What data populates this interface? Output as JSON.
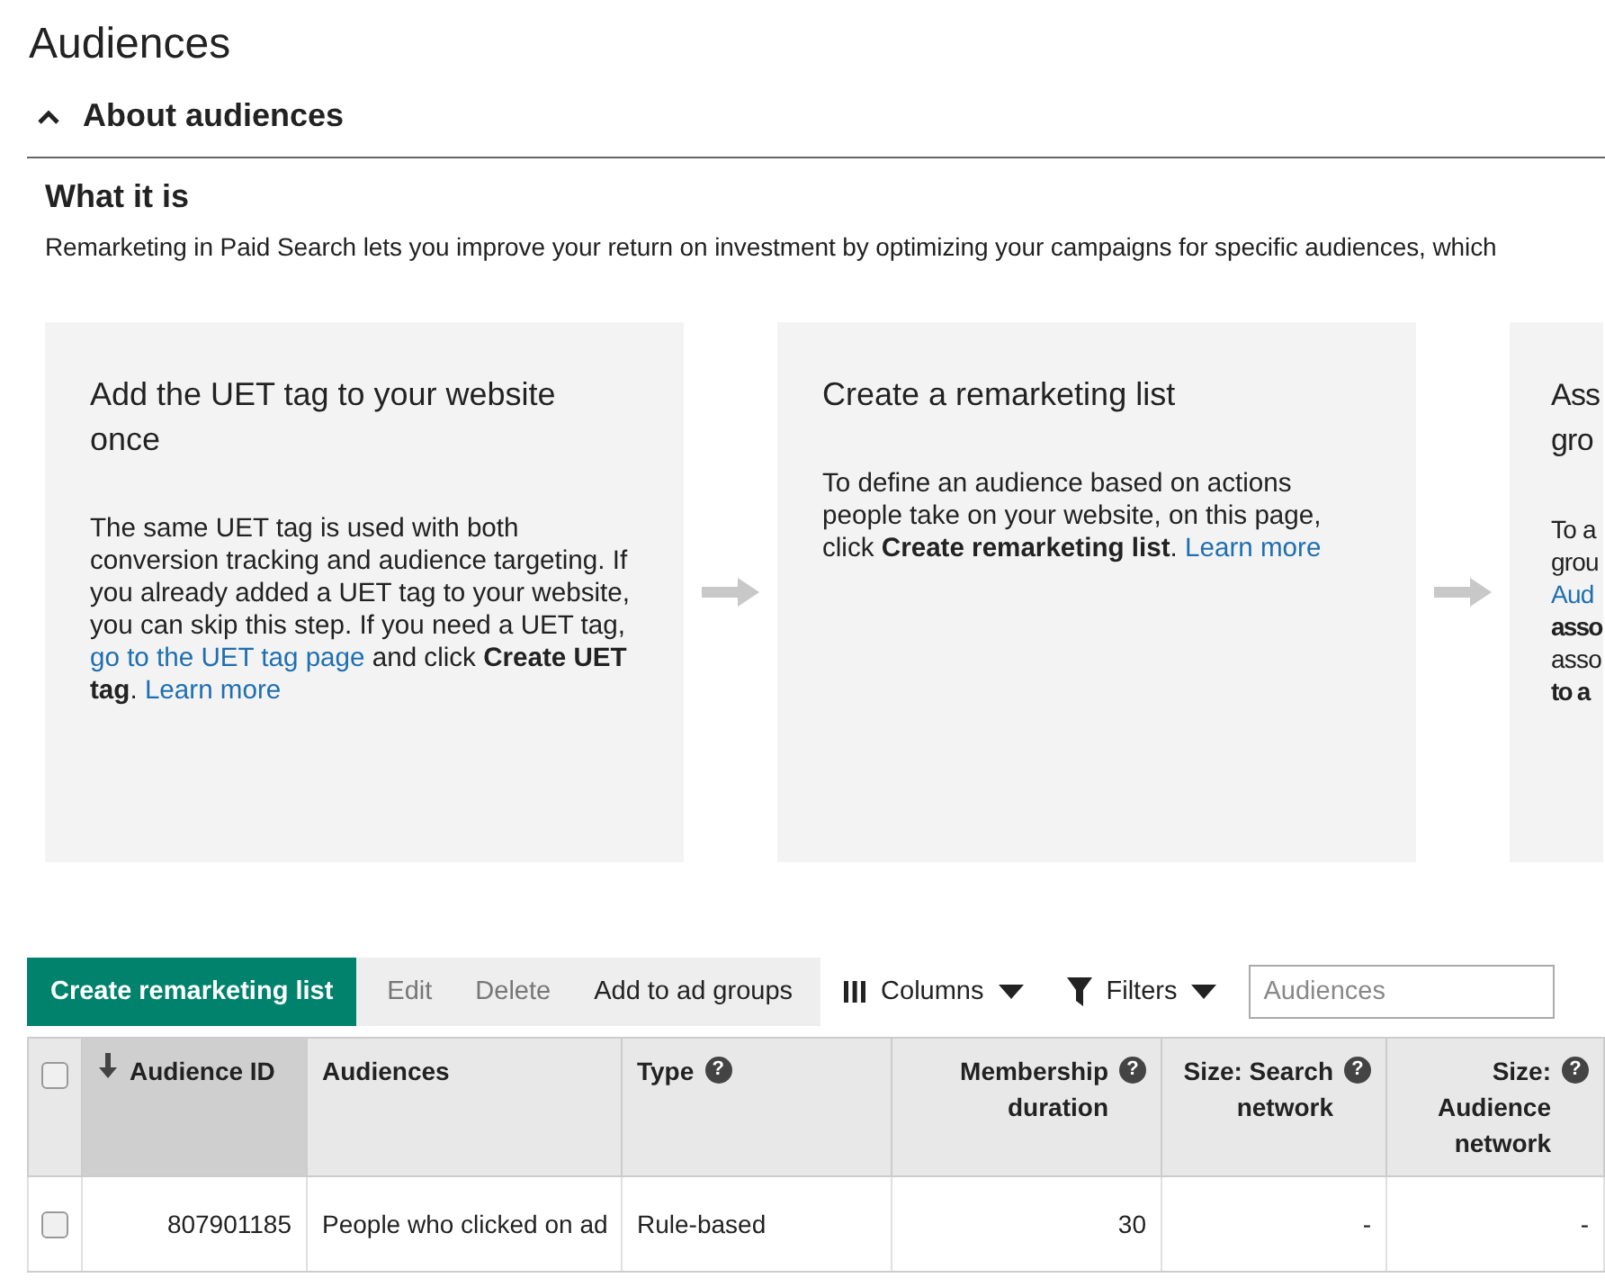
{
  "page_title": "Audiences",
  "section": {
    "title": "About audiences",
    "expanded": true
  },
  "what_it_is": {
    "heading": "What it is",
    "text": "Remarketing in Paid Search lets you improve your return on investment by optimizing your campaigns for specific audiences, which"
  },
  "steps": [
    {
      "title": "Add the UET tag to your website once",
      "body": [
        {
          "text": "The same UET tag is used with both conversion tracking and audience targeting. If you already added a UET tag to your website, you can skip this step. If you need a UET tag,",
          "kind": "text"
        },
        {
          "text": "go to the UET tag page",
          "kind": "link"
        },
        {
          "text": "and click **Create UET tag**.",
          "kind": "text"
        },
        {
          "text": "Learn more",
          "kind": "link"
        }
      ]
    },
    {
      "title": "Create a remarketing list",
      "body": [
        {
          "text": "To define an audience based on actions people take on your website, on this page, click **Create remarketing list**.",
          "kind": "text"
        },
        {
          "text": "Learn more",
          "kind": "link"
        }
      ]
    },
    {
      "title_lines": [
        "Ass",
        "gro"
      ],
      "body_lines": [
        {
          "text": "To a",
          "kind": "plain"
        },
        {
          "text": "grou",
          "kind": "plain"
        },
        {
          "text": "Aud",
          "kind": "link"
        },
        {
          "text": "asso",
          "kind": "bold"
        },
        {
          "text": "asso",
          "kind": "plain"
        },
        {
          "text": "to a",
          "kind": "bold"
        }
      ]
    }
  ],
  "toolbar": {
    "primary": "Create remarketing list",
    "actions": [
      "Edit",
      "Delete",
      "Add to ad groups"
    ],
    "columns": "Columns",
    "filters": "Filters",
    "search": {
      "placeholder": "Audiences"
    }
  },
  "table": {
    "columns": [
      {
        "label": "Audience ID",
        "sorted": true
      },
      {
        "label": "Audiences",
        "sorted": false
      },
      {
        "label": "Type",
        "sorted": false,
        "help": "?"
      },
      {
        "label": "Membership duration",
        "sorted": false,
        "help": "?"
      },
      {
        "label": "Size: Search network",
        "sorted": false,
        "help": "?"
      },
      {
        "label": "Size: Audience network",
        "sorted": false,
        "help": "?"
      }
    ],
    "all_checked": false,
    "rows": [
      {
        "checked": false,
        "cells": [
          "807901185",
          "People who clicked on ad",
          "Rule-based",
          "30",
          "-",
          "-"
        ]
      }
    ]
  }
}
